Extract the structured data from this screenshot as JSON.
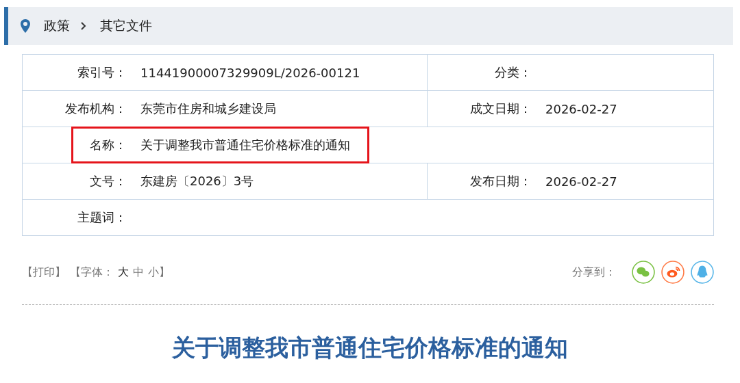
{
  "breadcrumb": {
    "items": [
      "政策",
      "其它文件"
    ]
  },
  "info_table": {
    "rows": [
      {
        "kind": "pair",
        "cells": [
          {
            "label": "索引号：",
            "value": "11441900007329909L/2026-00121"
          },
          {
            "label": "分类："
          }
        ]
      },
      {
        "kind": "pair",
        "cells": [
          {
            "label": "发布机构：",
            "value": "东莞市住房和城乡建设局"
          },
          {
            "label": "成文日期：",
            "value": "2026-02-27"
          }
        ]
      },
      {
        "kind": "wide",
        "highlighted": true,
        "cells": [
          {
            "label": "名称：",
            "value": "关于调整我市普通住宅价格标准的通知"
          }
        ]
      },
      {
        "kind": "pair",
        "cells": [
          {
            "label": "文号：",
            "value": "东建房〔2026〕3号"
          },
          {
            "label": "发布日期：",
            "value": "2026-02-27"
          }
        ]
      },
      {
        "kind": "wide",
        "highlighted": false,
        "cells": [
          {
            "label": "主题词："
          }
        ]
      }
    ]
  },
  "tools": {
    "print": "【打印】",
    "font_open": "【字体：",
    "font_sizes": [
      {
        "label": "大",
        "selected": true
      },
      {
        "label": "中",
        "selected": false
      },
      {
        "label": "小",
        "selected": false
      }
    ],
    "font_close": "】"
  },
  "share": {
    "label": "分享到：",
    "targets": [
      {
        "kind": "wechat"
      },
      {
        "kind": "weibo"
      },
      {
        "kind": "qq"
      }
    ]
  },
  "article": {
    "title": "关于调整我市普通住宅价格标准的通知"
  }
}
